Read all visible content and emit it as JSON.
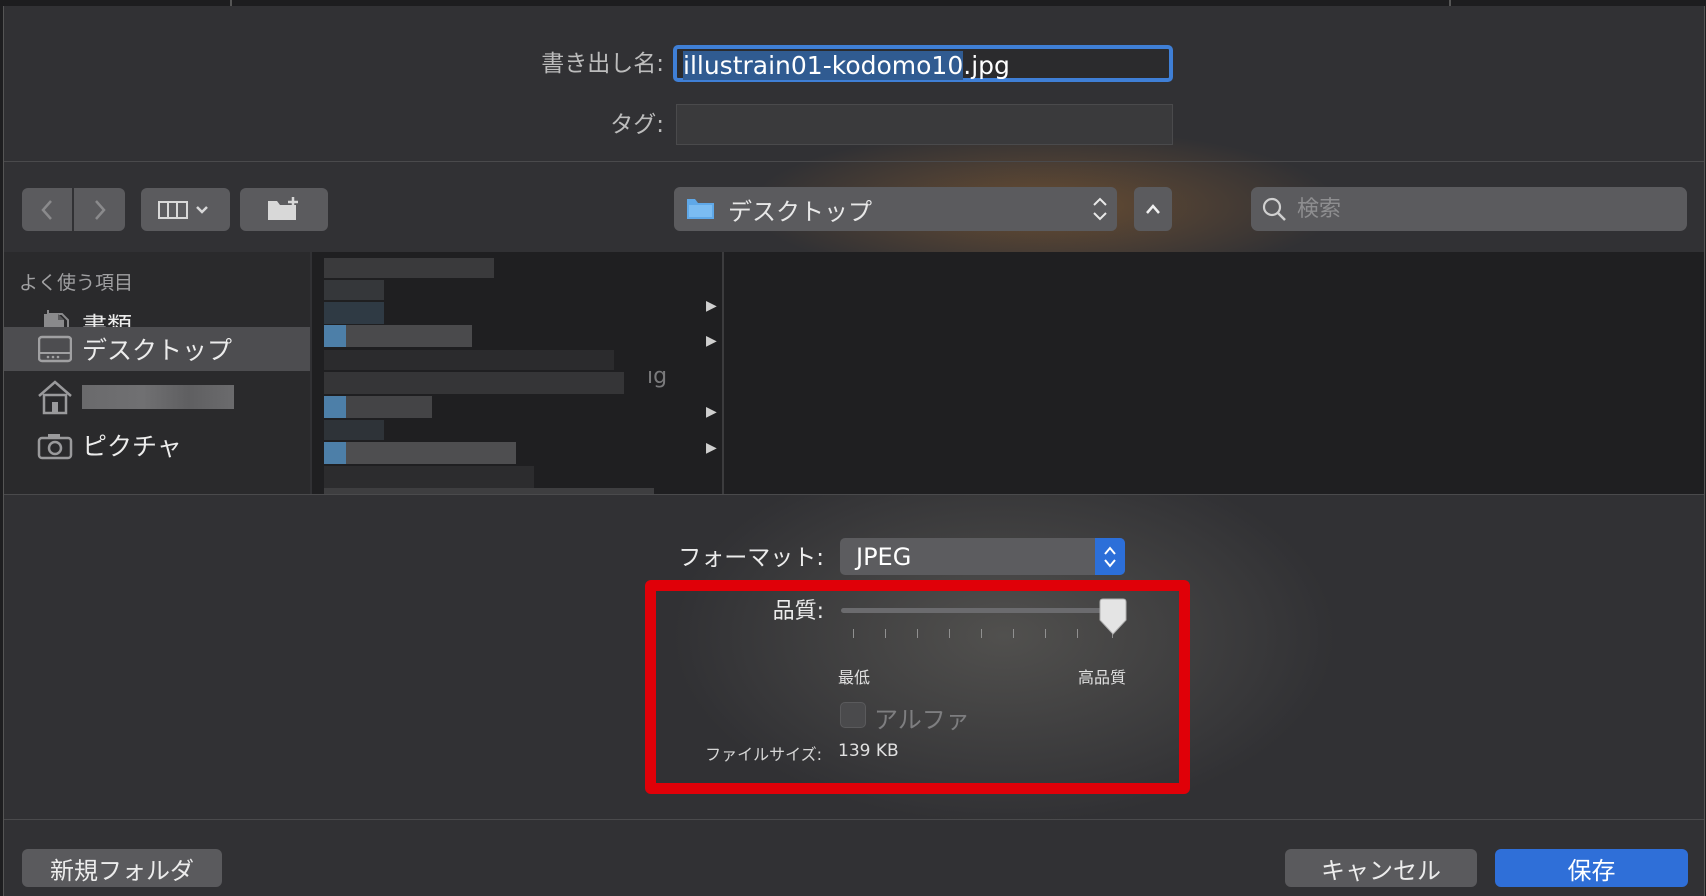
{
  "header": {
    "export_name_label": "書き出し名:",
    "filename_selected": "illustrain01-kodomo10",
    "filename_ext": ".jpg",
    "tags_label": "タグ:"
  },
  "toolbar": {
    "location": "デスクトップ",
    "search_placeholder": "検索"
  },
  "sidebar": {
    "section_title": "よく使う項目",
    "items": [
      {
        "label": "書類",
        "icon": "document-icon",
        "selected": false
      },
      {
        "label": "デスクトップ",
        "icon": "desktop-icon",
        "selected": true
      },
      {
        "label": "",
        "icon": "home-icon",
        "selected": false
      },
      {
        "label": "ピクチャ",
        "icon": "camera-icon",
        "selected": false
      }
    ]
  },
  "browser": {
    "partial_text": "ıg"
  },
  "options": {
    "format_label": "フォーマット:",
    "format_value": "JPEG",
    "quality_label": "品質:",
    "quality_value": 1.0,
    "quality_min_label": "最低",
    "quality_max_label": "高品質",
    "alpha_label": "アルファ",
    "alpha_checked": false,
    "filesize_label": "ファイルサイズ:",
    "filesize_value": "139 KB"
  },
  "footer": {
    "new_folder": "新規フォルダ",
    "cancel": "キャンセル",
    "save": "保存"
  },
  "colors": {
    "accent": "#2f6fd8",
    "highlight_box": "#e00008"
  }
}
